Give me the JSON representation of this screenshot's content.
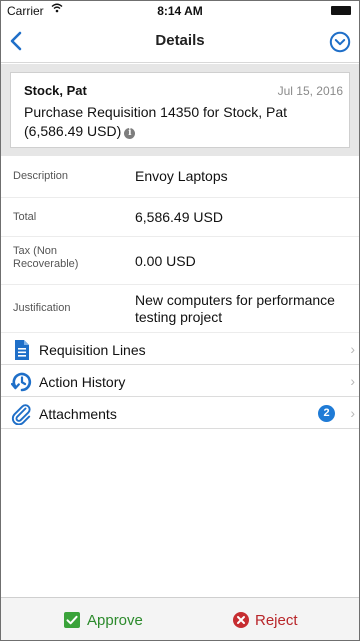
{
  "status_bar": {
    "carrier": "Carrier",
    "time": "8:14 AM"
  },
  "nav": {
    "title": "Details"
  },
  "header": {
    "requester": "Stock, Pat",
    "date": "Jul 15, 2016",
    "subject": "Purchase Requisition 14350 for Stock, Pat (6,586.49 USD)"
  },
  "fields": [
    {
      "label": "Description",
      "value": "Envoy Laptops"
    },
    {
      "label": "Total",
      "value": "6,586.49 USD"
    },
    {
      "label": "Tax (Non Recoverable)",
      "value": "0.00 USD"
    },
    {
      "label": "Justification",
      "value": "New computers for performance testing project"
    }
  ],
  "rows": [
    {
      "label": "Requisition Lines",
      "icon": "document-icon"
    },
    {
      "label": "Action History",
      "icon": "history-icon"
    },
    {
      "label": "Attachments",
      "icon": "paperclip-icon",
      "badge": "2"
    }
  ],
  "actions": {
    "approve": "Approve",
    "reject": "Reject"
  },
  "colors": {
    "accent": "#1f7bd6",
    "approve": "#2c8a2c",
    "reject": "#b8262a"
  }
}
